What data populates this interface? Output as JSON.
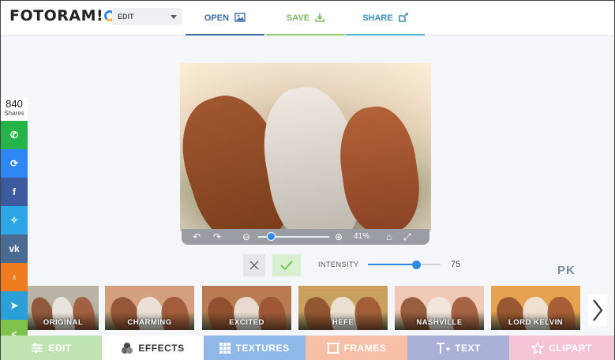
{
  "header": {
    "logo_text": "FOTORAM",
    "logo_suffix": "!",
    "mode": "EDIT",
    "nav": {
      "open": "OPEN",
      "save": "SAVE",
      "share": "SHARE"
    }
  },
  "social": {
    "count": "840",
    "count_label": "Shares",
    "buttons": [
      {
        "name": "whatsapp",
        "color": "#25b34a",
        "glyph": "✆"
      },
      {
        "name": "messenger",
        "color": "#2f87f6",
        "glyph": "⟳"
      },
      {
        "name": "facebook",
        "color": "#3b5b9e",
        "glyph": "f"
      },
      {
        "name": "twitter",
        "color": "#2da6e6",
        "glyph": "✧"
      },
      {
        "name": "vk",
        "color": "#4a6b91",
        "glyph": "vk"
      },
      {
        "name": "odnoklassniki",
        "color": "#ef7b1f",
        "glyph": "♁"
      },
      {
        "name": "telegram",
        "color": "#2a9fd8",
        "glyph": "➤"
      },
      {
        "name": "share",
        "color": "#7cc24d",
        "glyph": "<"
      }
    ]
  },
  "viewer": {
    "zoom": "41%",
    "zoom_level": 0.18
  },
  "intensity": {
    "label": "INTENSITY",
    "value": "75",
    "fraction": 0.66
  },
  "watermark": "PK",
  "filters": [
    {
      "label": "ORIGINAL",
      "tint": "#b9b3a6"
    },
    {
      "label": "CHARMING",
      "tint": "#d2a07e"
    },
    {
      "label": "EXCITED",
      "tint": "#b97c52"
    },
    {
      "label": "HEFE",
      "tint": "#c9a15f"
    },
    {
      "label": "NASHVILLE",
      "tint": "#f1c9b7"
    },
    {
      "label": "LORD KELVIN",
      "tint": "#e6a24f"
    }
  ],
  "tabs": [
    {
      "label": "EDIT",
      "bg": "#bfe4b1",
      "color": "#ffffff"
    },
    {
      "label": "EFFECTS",
      "bg": "#ffffff",
      "color": "#333333"
    },
    {
      "label": "TEXTURES",
      "bg": "#8fb8e8",
      "color": "#ffffff"
    },
    {
      "label": "FRAMES",
      "bg": "#f6bfa6",
      "color": "#ffffff"
    },
    {
      "label": "TEXT",
      "bg": "#aab0d8",
      "color": "#ffffff"
    },
    {
      "label": "CLIPART",
      "bg": "#f4c3d6",
      "color": "#ffffff"
    }
  ]
}
